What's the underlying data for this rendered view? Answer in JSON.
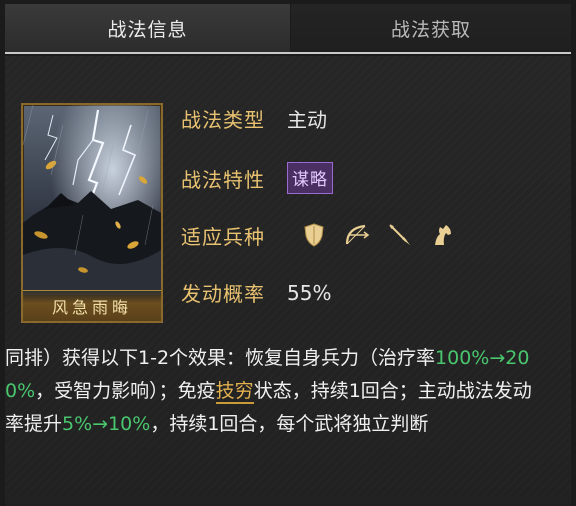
{
  "tabs": [
    {
      "label": "战法信息",
      "active": true
    },
    {
      "label": "战法获取",
      "active": false
    }
  ],
  "card": {
    "title": "风急雨晦"
  },
  "info": {
    "type_label": "战法类型",
    "type_value": "主动",
    "trait_label": "战法特性",
    "trait_value": "谋略",
    "troops_label": "适应兵种",
    "troops": [
      "shield-icon",
      "bow-icon",
      "spear-icon",
      "horse-icon"
    ],
    "rate_label": "发动概率",
    "rate_value": "55%"
  },
  "description": {
    "p1": "同排）获得以下1-2个效果：恢复自身兵力（治疗率",
    "g1": "100%→200%",
    "p2": "，受智力影响）；免疫",
    "k1": "技穷",
    "p3": "状态，持续1回合；主动战法发动率提升",
    "g2": "5%→10%",
    "p4": "，持续1回合，每个武将独立判断"
  },
  "colors": {
    "label_gold": "#e8c270",
    "highlight_green": "#49c66e",
    "keyword_gold": "#e3b14f",
    "trait_purple": "#4a2f63"
  }
}
